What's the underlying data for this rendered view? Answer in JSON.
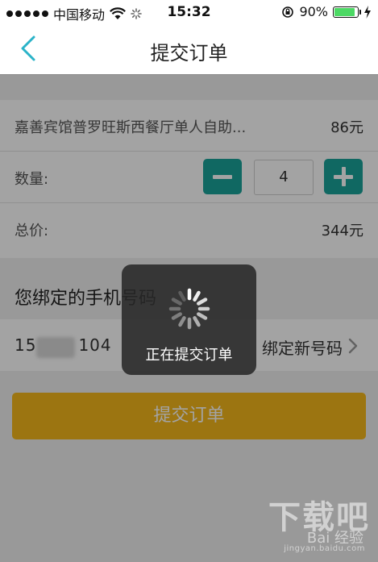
{
  "status_bar": {
    "carrier": "中国移动",
    "time": "15:32",
    "battery_percent": "90%",
    "battery_level": 0.9
  },
  "nav": {
    "title": "提交订单"
  },
  "order": {
    "item_name": "嘉善宾馆普罗旺斯西餐厅单人自助...",
    "unit_price": "86元",
    "quantity_label": "数量:",
    "quantity_value": "4",
    "total_label": "总价:",
    "total_value": "344元"
  },
  "phone": {
    "header": "您绑定的手机号码",
    "number_prefix": "15",
    "number_suffix": "104",
    "bind_new_label": "绑定新号码"
  },
  "submit": {
    "label": "提交订单"
  },
  "loading_toast": {
    "text": "正在提交订单"
  },
  "watermark": {
    "big": "下载吧",
    "mid": "Bai 经验",
    "small": "jingyan.baidu.com"
  },
  "colors": {
    "accent_teal": "#1aa39a",
    "submit_yellow": "#f5b81c",
    "nav_back": "#2ab3c8"
  }
}
